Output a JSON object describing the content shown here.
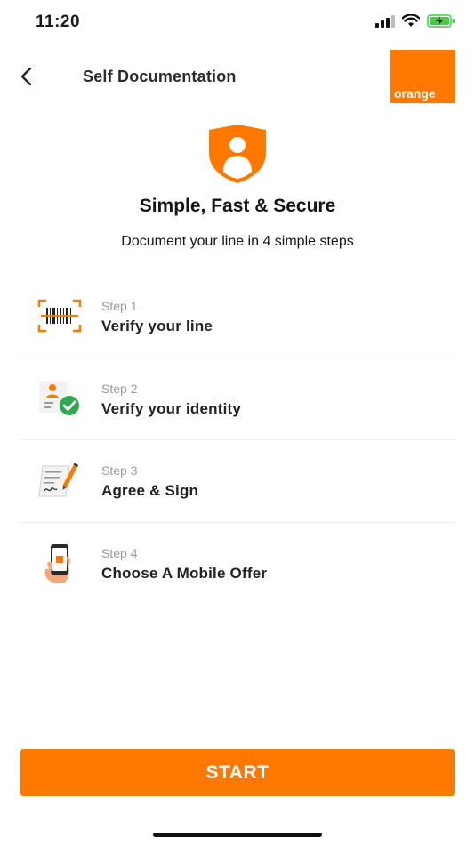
{
  "status": {
    "time": "11:20"
  },
  "header": {
    "title": "Self Documentation",
    "logo_text": "orange"
  },
  "hero": {
    "title": "Simple, Fast & Secure",
    "subtitle": "Document your line in 4 simple steps"
  },
  "steps": [
    {
      "number": "Step 1",
      "label": "Verify your line",
      "icon": "barcode-scan-icon"
    },
    {
      "number": "Step 2",
      "label": "Verify your identity",
      "icon": "id-check-icon"
    },
    {
      "number": "Step 3",
      "label": "Agree & Sign",
      "icon": "document-sign-icon"
    },
    {
      "number": "Step 4",
      "label": "Choose A Mobile Offer",
      "icon": "phone-in-hand-icon"
    }
  ],
  "actions": {
    "start_label": "START"
  },
  "colors": {
    "brand": "#ff7900",
    "battery": "#3fcf3f",
    "check": "#2fa84f"
  }
}
